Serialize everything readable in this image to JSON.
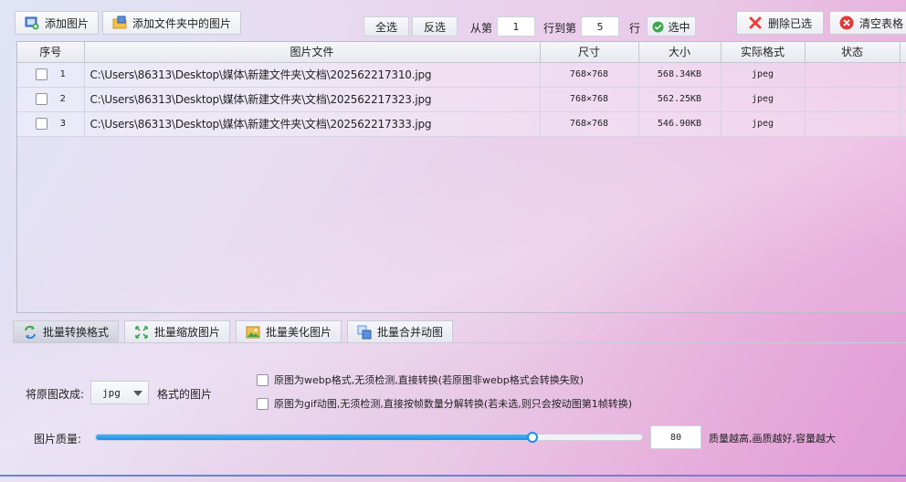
{
  "toolbar": {
    "add_image": "添加图片",
    "add_folder": "添加文件夹中的图片",
    "select_all": "全选",
    "invert_select": "反选",
    "from_label": "从第",
    "from_value": "1",
    "to_label": "行到第",
    "to_value": "5",
    "row_label": "行",
    "select_range": "选中",
    "delete_selected": "删除已选",
    "clear_table": "清空表格"
  },
  "table": {
    "headers": [
      "序号",
      "图片文件",
      "尺寸",
      "大小",
      "实际格式",
      "状态"
    ],
    "rows": [
      {
        "index": "1",
        "path": "C:\\Users\\86313\\Desktop\\媒体\\新建文件夹\\文档\\202562217310.jpg",
        "size": "768×768",
        "filesize": "568.34KB",
        "format": "jpeg",
        "status": ""
      },
      {
        "index": "2",
        "path": "C:\\Users\\86313\\Desktop\\媒体\\新建文件夹\\文档\\202562217323.jpg",
        "size": "768×768",
        "filesize": "562.25KB",
        "format": "jpeg",
        "status": ""
      },
      {
        "index": "3",
        "path": "C:\\Users\\86313\\Desktop\\媒体\\新建文件夹\\文档\\202562217333.jpg",
        "size": "768×768",
        "filesize": "546.90KB",
        "format": "jpeg",
        "status": ""
      }
    ]
  },
  "tabs": [
    {
      "label": "批量转换格式",
      "active": true
    },
    {
      "label": "批量缩放图片",
      "active": false
    },
    {
      "label": "批量美化图片",
      "active": false
    },
    {
      "label": "批量合并动图",
      "active": false
    }
  ],
  "convert": {
    "convert_label": "将原图改成:",
    "format_value": "jpg",
    "format_suffix": "格式的图片",
    "webp_option": "原图为webp格式,无须检测,直接转换(若原图非webp格式会转换失败)",
    "gif_option": "原图为gif动图,无须检测,直接按帧数量分解转换(若未选,则只会按动图第1帧转换)",
    "quality_label": "图片质量:",
    "quality_value": "80",
    "quality_hint": "质量越高,画质越好,容量越大",
    "quality_fraction": 0.8
  },
  "colors": {
    "accent": "#1e8fe6",
    "delete_icon": "#e8413c",
    "clear_icon": "#e23a3a",
    "ok_icon": "#3aa84a"
  }
}
